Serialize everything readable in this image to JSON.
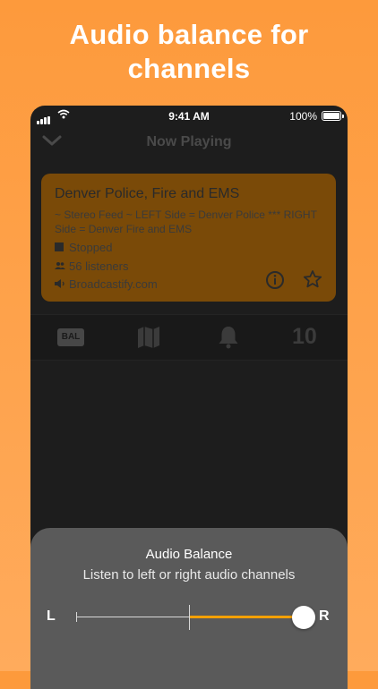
{
  "headline": {
    "line1": "Audio balance for",
    "line2": "channels"
  },
  "status_bar": {
    "time": "9:41 AM",
    "battery": "100%"
  },
  "nav": {
    "title": "Now Playing",
    "back_icon": "chevron-down-icon"
  },
  "stream": {
    "title": "Denver Police, Fire and EMS",
    "description": "~ Stereo Feed ~ LEFT Side = Denver Police *** RIGHT Side = Denver Fire and EMS",
    "status": "Stopped",
    "listeners": "56 listeners",
    "provider": "Broadcastify.com"
  },
  "toolbar": {
    "balance_label": "BAL",
    "count": "10",
    "icons": [
      "balance-icon",
      "map-icon",
      "bell-icon"
    ]
  },
  "audio_balance": {
    "title": "Audio Balance",
    "subtitle": "Listen to left or right audio channels",
    "left_label": "L",
    "right_label": "R",
    "value_fraction": 1.0
  },
  "colors": {
    "background": "#fd9a3c",
    "card": "#7a4a08",
    "accent": "#f4a000",
    "sheet": "#5a5a5a"
  }
}
